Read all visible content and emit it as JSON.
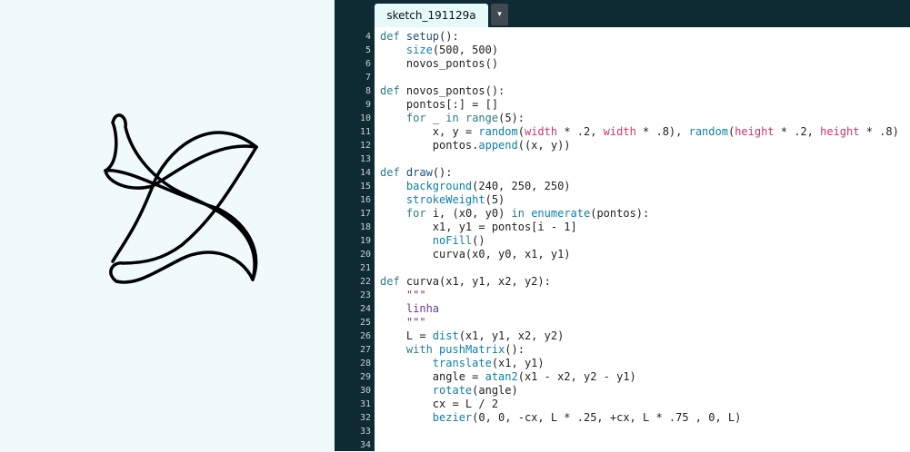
{
  "editor": {
    "tab_label": "sketch_191129a",
    "tab_menu_icon": "▾"
  },
  "code": {
    "lines": [
      {
        "n": "4",
        "segs": [
          [
            "kw",
            "def "
          ],
          [
            "nm",
            "setup"
          ],
          [
            "",
            "():"
          ]
        ]
      },
      {
        "n": "5",
        "segs": [
          [
            "",
            "    "
          ],
          [
            "bi",
            "size"
          ],
          [
            "",
            "(500, 500)"
          ]
        ]
      },
      {
        "n": "6",
        "segs": [
          [
            "",
            "    novos_pontos()"
          ]
        ]
      },
      {
        "n": "7",
        "segs": []
      },
      {
        "n": "8",
        "segs": [
          [
            "kw",
            "def "
          ],
          [
            "",
            "novos_pontos():"
          ]
        ]
      },
      {
        "n": "9",
        "segs": [
          [
            "",
            "    pontos[:] = []"
          ]
        ]
      },
      {
        "n": "10",
        "segs": [
          [
            "",
            "    "
          ],
          [
            "kw",
            "for"
          ],
          [
            "",
            " _ "
          ],
          [
            "kw",
            "in"
          ],
          [
            "",
            " "
          ],
          [
            "kw",
            "range"
          ],
          [
            "",
            "(5):"
          ]
        ]
      },
      {
        "n": "11",
        "segs": [
          [
            "",
            "        x, y = "
          ],
          [
            "bi",
            "random"
          ],
          [
            "",
            "("
          ],
          [
            "pk",
            "width"
          ],
          [
            "",
            " * .2, "
          ],
          [
            "pk",
            "width"
          ],
          [
            "",
            " * .8), "
          ],
          [
            "bi",
            "random"
          ],
          [
            "",
            "("
          ],
          [
            "pk",
            "height"
          ],
          [
            "",
            " * .2, "
          ],
          [
            "pk",
            "height"
          ],
          [
            "",
            " * .8)"
          ]
        ]
      },
      {
        "n": "12",
        "segs": [
          [
            "",
            "        pontos."
          ],
          [
            "bi",
            "append"
          ],
          [
            "",
            "((x, y))"
          ]
        ]
      },
      {
        "n": "13",
        "segs": []
      },
      {
        "n": "14",
        "segs": [
          [
            "kw",
            "def "
          ],
          [
            "nm",
            "draw"
          ],
          [
            "",
            "():"
          ]
        ]
      },
      {
        "n": "15",
        "segs": [
          [
            "",
            "    "
          ],
          [
            "bi",
            "background"
          ],
          [
            "",
            "(240, 250, 250)"
          ]
        ]
      },
      {
        "n": "16",
        "segs": [
          [
            "",
            "    "
          ],
          [
            "bi",
            "strokeWeight"
          ],
          [
            "",
            "(5)"
          ]
        ]
      },
      {
        "n": "17",
        "segs": [
          [
            "",
            "    "
          ],
          [
            "kw",
            "for"
          ],
          [
            "",
            " i, (x0, y0) "
          ],
          [
            "kw",
            "in"
          ],
          [
            "",
            " "
          ],
          [
            "bi",
            "enumerate"
          ],
          [
            "",
            "(pontos):"
          ]
        ]
      },
      {
        "n": "18",
        "segs": [
          [
            "",
            "        x1, y1 = pontos[i - 1]"
          ]
        ]
      },
      {
        "n": "19",
        "segs": [
          [
            "",
            "        "
          ],
          [
            "bi",
            "noFill"
          ],
          [
            "",
            "()"
          ]
        ]
      },
      {
        "n": "20",
        "segs": [
          [
            "",
            "        curva(x0, y0, x1, y1)"
          ]
        ]
      },
      {
        "n": "21",
        "segs": []
      },
      {
        "n": "22",
        "segs": [
          [
            "kw",
            "def "
          ],
          [
            "",
            "curva(x1, y1, x2, y2):"
          ]
        ]
      },
      {
        "n": "23",
        "segs": [
          [
            "",
            "    "
          ],
          [
            "str",
            "\"\"\""
          ]
        ]
      },
      {
        "n": "24",
        "segs": [
          [
            "",
            "    "
          ],
          [
            "str",
            "linha"
          ]
        ]
      },
      {
        "n": "25",
        "segs": [
          [
            "",
            "    "
          ],
          [
            "str",
            "\"\"\""
          ]
        ]
      },
      {
        "n": "26",
        "segs": [
          [
            "",
            "    L = "
          ],
          [
            "bi",
            "dist"
          ],
          [
            "",
            "(x1, y1, x2, y2)"
          ]
        ]
      },
      {
        "n": "27",
        "segs": [
          [
            "",
            "    "
          ],
          [
            "kw",
            "with"
          ],
          [
            "",
            " "
          ],
          [
            "bi",
            "pushMatrix"
          ],
          [
            "",
            "():"
          ]
        ]
      },
      {
        "n": "28",
        "segs": [
          [
            "",
            "        "
          ],
          [
            "bi",
            "translate"
          ],
          [
            "",
            "(x1, y1)"
          ]
        ]
      },
      {
        "n": "29",
        "segs": [
          [
            "",
            "        angle = "
          ],
          [
            "bi",
            "atan2"
          ],
          [
            "",
            "(x1 - x2, y2 - y1)"
          ]
        ]
      },
      {
        "n": "30",
        "segs": [
          [
            "",
            "        "
          ],
          [
            "bi",
            "rotate"
          ],
          [
            "",
            "(angle)"
          ]
        ]
      },
      {
        "n": "31",
        "segs": [
          [
            "",
            "        cx = L / 2"
          ]
        ]
      },
      {
        "n": "32",
        "segs": [
          [
            "",
            "        "
          ],
          [
            "bi",
            "bezier"
          ],
          [
            "",
            "(0, 0, -cx, L * .25, +cx, L * .75 , 0, L)"
          ]
        ]
      },
      {
        "n": "33",
        "segs": []
      },
      {
        "n": "34",
        "segs": []
      }
    ]
  }
}
